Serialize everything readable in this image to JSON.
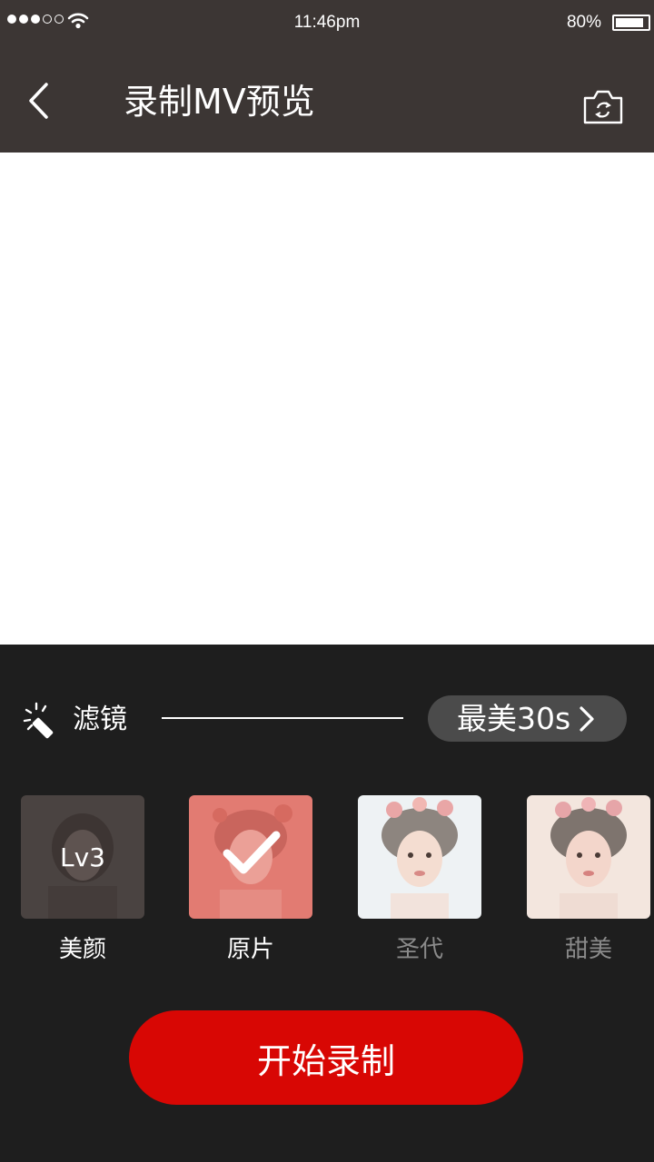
{
  "status_bar": {
    "time": "11:46pm",
    "battery": "80%",
    "signal_filled": 3,
    "signal_total": 5,
    "battery_level": 0.8
  },
  "header": {
    "title": "录制MV预览",
    "back_icon": "chevron-left-icon",
    "camera_icon": "camera-switch-icon"
  },
  "panel": {
    "filter_label": "滤镜",
    "filter_icon": "magic-wand-icon",
    "best_button_label": "最美30s",
    "record_button_label": "开始录制"
  },
  "filters": [
    {
      "name": "美颜",
      "badge": "Lv3",
      "selected": false,
      "name_color": "#ffffff"
    },
    {
      "name": "原片",
      "badge": "",
      "selected": true,
      "name_color": "#ffffff"
    },
    {
      "name": "圣代",
      "badge": "",
      "selected": false,
      "name_color": "#8a8a8a"
    },
    {
      "name": "甜美",
      "badge": "",
      "selected": false,
      "name_color": "#8a8a8a"
    }
  ],
  "colors": {
    "header_bg": "#3c3634",
    "panel_bg": "#1e1e1e",
    "record_button": "#d80704",
    "best_button_bg": "#4b4b4b"
  }
}
